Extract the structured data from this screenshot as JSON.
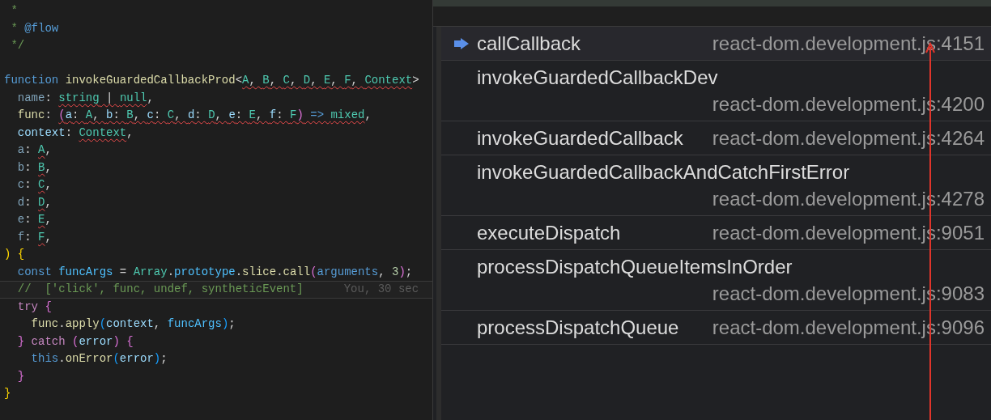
{
  "editor": {
    "lines": [
      {
        "current": false,
        "tokens": [
          {
            "text": " *",
            "kind": "comment",
            "squiggly": false
          }
        ]
      },
      {
        "current": false,
        "tokens": [
          {
            "text": " * ",
            "kind": "comment",
            "squiggly": false
          },
          {
            "text": "@flow",
            "kind": "tag",
            "squiggly": false
          }
        ]
      },
      {
        "current": false,
        "tokens": [
          {
            "text": " */",
            "kind": "comment",
            "squiggly": false
          }
        ]
      },
      {
        "current": false
      },
      {
        "current": false,
        "tokens": [
          {
            "text": "function ",
            "kind": "keyword",
            "squiggly": false
          },
          {
            "text": "invokeGuardedCallbackProd",
            "kind": "function",
            "squiggly": false
          },
          {
            "text": "<",
            "kind": "punct",
            "squiggly": false
          },
          {
            "text": "A",
            "kind": "type",
            "squiggly": true
          },
          {
            "text": ", ",
            "kind": "punct",
            "squiggly": true
          },
          {
            "text": "B",
            "kind": "type",
            "squiggly": true
          },
          {
            "text": ", ",
            "kind": "punct",
            "squiggly": true
          },
          {
            "text": "C",
            "kind": "type",
            "squiggly": true
          },
          {
            "text": ", ",
            "kind": "punct",
            "squiggly": true
          },
          {
            "text": "D",
            "kind": "type",
            "squiggly": true
          },
          {
            "text": ", ",
            "kind": "punct",
            "squiggly": true
          },
          {
            "text": "E",
            "kind": "type",
            "squiggly": true
          },
          {
            "text": ", ",
            "kind": "punct",
            "squiggly": true
          },
          {
            "text": "F",
            "kind": "type",
            "squiggly": true
          },
          {
            "text": ", ",
            "kind": "punct",
            "squiggly": true
          },
          {
            "text": "Context",
            "kind": "type",
            "squiggly": true
          },
          {
            "text": ">",
            "kind": "punct",
            "squiggly": false
          }
        ]
      },
      {
        "current": false,
        "tokens": [
          {
            "text": "  name",
            "kind": "param_dim",
            "squiggly": false
          },
          {
            "text": ": ",
            "kind": "punct",
            "squiggly": false
          },
          {
            "text": "string",
            "kind": "type",
            "squiggly": true
          },
          {
            "text": " | ",
            "kind": "punct",
            "squiggly": true
          },
          {
            "text": "null",
            "kind": "type",
            "squiggly": true
          },
          {
            "text": ",",
            "kind": "punct",
            "squiggly": false
          }
        ]
      },
      {
        "current": false,
        "tokens": [
          {
            "text": "  func",
            "kind": "function",
            "squiggly": false
          },
          {
            "text": ": ",
            "kind": "punct",
            "squiggly": false
          },
          {
            "text": "(",
            "kind": "bracket2",
            "squiggly": true
          },
          {
            "text": "a",
            "kind": "param",
            "squiggly": true
          },
          {
            "text": ": ",
            "kind": "punct",
            "squiggly": true
          },
          {
            "text": "A",
            "kind": "type",
            "squiggly": true
          },
          {
            "text": ", ",
            "kind": "punct",
            "squiggly": true
          },
          {
            "text": "b",
            "kind": "param",
            "squiggly": true
          },
          {
            "text": ": ",
            "kind": "punct",
            "squiggly": true
          },
          {
            "text": "B",
            "kind": "type",
            "squiggly": true
          },
          {
            "text": ", ",
            "kind": "punct",
            "squiggly": true
          },
          {
            "text": "c",
            "kind": "param",
            "squiggly": true
          },
          {
            "text": ": ",
            "kind": "punct",
            "squiggly": true
          },
          {
            "text": "C",
            "kind": "type",
            "squiggly": true
          },
          {
            "text": ", ",
            "kind": "punct",
            "squiggly": true
          },
          {
            "text": "d",
            "kind": "param",
            "squiggly": true
          },
          {
            "text": ": ",
            "kind": "punct",
            "squiggly": true
          },
          {
            "text": "D",
            "kind": "type",
            "squiggly": true
          },
          {
            "text": ", ",
            "kind": "punct",
            "squiggly": true
          },
          {
            "text": "e",
            "kind": "param",
            "squiggly": true
          },
          {
            "text": ": ",
            "kind": "punct",
            "squiggly": true
          },
          {
            "text": "E",
            "kind": "type",
            "squiggly": true
          },
          {
            "text": ", ",
            "kind": "punct",
            "squiggly": true
          },
          {
            "text": "f",
            "kind": "param",
            "squiggly": true
          },
          {
            "text": ": ",
            "kind": "punct",
            "squiggly": true
          },
          {
            "text": "F",
            "kind": "type",
            "squiggly": true
          },
          {
            "text": ")",
            "kind": "bracket2",
            "squiggly": true
          },
          {
            "text": " => ",
            "kind": "keyword",
            "squiggly": true
          },
          {
            "text": "mixed",
            "kind": "type",
            "squiggly": true
          },
          {
            "text": ",",
            "kind": "punct",
            "squiggly": false
          }
        ]
      },
      {
        "current": false,
        "tokens": [
          {
            "text": "  context",
            "kind": "param",
            "squiggly": false
          },
          {
            "text": ": ",
            "kind": "punct",
            "squiggly": false
          },
          {
            "text": "Context",
            "kind": "type",
            "squiggly": true
          },
          {
            "text": ",",
            "kind": "punct",
            "squiggly": false
          }
        ]
      },
      {
        "current": false,
        "tokens": [
          {
            "text": "  a",
            "kind": "param_dim",
            "squiggly": false
          },
          {
            "text": ": ",
            "kind": "punct",
            "squiggly": false
          },
          {
            "text": "A",
            "kind": "type",
            "squiggly": true
          },
          {
            "text": ",",
            "kind": "punct",
            "squiggly": false
          }
        ]
      },
      {
        "current": false,
        "tokens": [
          {
            "text": "  b",
            "kind": "param_dim",
            "squiggly": false
          },
          {
            "text": ": ",
            "kind": "punct",
            "squiggly": false
          },
          {
            "text": "B",
            "kind": "type",
            "squiggly": true
          },
          {
            "text": ",",
            "kind": "punct",
            "squiggly": false
          }
        ]
      },
      {
        "current": false,
        "tokens": [
          {
            "text": "  c",
            "kind": "param_dim",
            "squiggly": false
          },
          {
            "text": ": ",
            "kind": "punct",
            "squiggly": false
          },
          {
            "text": "C",
            "kind": "type",
            "squiggly": true
          },
          {
            "text": ",",
            "kind": "punct",
            "squiggly": false
          }
        ]
      },
      {
        "current": false,
        "tokens": [
          {
            "text": "  d",
            "kind": "param_dim",
            "squiggly": false
          },
          {
            "text": ": ",
            "kind": "punct",
            "squiggly": false
          },
          {
            "text": "D",
            "kind": "type",
            "squiggly": true
          },
          {
            "text": ",",
            "kind": "punct",
            "squiggly": false
          }
        ]
      },
      {
        "current": false,
        "tokens": [
          {
            "text": "  e",
            "kind": "param_dim",
            "squiggly": false
          },
          {
            "text": ": ",
            "kind": "punct",
            "squiggly": false
          },
          {
            "text": "E",
            "kind": "type",
            "squiggly": true
          },
          {
            "text": ",",
            "kind": "punct",
            "squiggly": false
          }
        ]
      },
      {
        "current": false,
        "tokens": [
          {
            "text": "  f",
            "kind": "param_dim",
            "squiggly": false
          },
          {
            "text": ": ",
            "kind": "punct",
            "squiggly": false
          },
          {
            "text": "F",
            "kind": "type",
            "squiggly": true
          },
          {
            "text": ",",
            "kind": "punct",
            "squiggly": false
          }
        ]
      },
      {
        "current": false,
        "tokens": [
          {
            "text": ") ",
            "kind": "bracket",
            "squiggly": false
          },
          {
            "text": "{",
            "kind": "bracket",
            "squiggly": false
          }
        ]
      },
      {
        "current": false,
        "tokens": [
          {
            "text": "  const ",
            "kind": "keyword",
            "squiggly": false
          },
          {
            "text": "funcArgs",
            "kind": "variable",
            "squiggly": false
          },
          {
            "text": " = ",
            "kind": "punct",
            "squiggly": false
          },
          {
            "text": "Array",
            "kind": "type",
            "squiggly": false
          },
          {
            "text": ".",
            "kind": "punct",
            "squiggly": false
          },
          {
            "text": "prototype",
            "kind": "variable",
            "squiggly": false
          },
          {
            "text": ".",
            "kind": "punct",
            "squiggly": false
          },
          {
            "text": "slice",
            "kind": "function",
            "squiggly": false
          },
          {
            "text": ".",
            "kind": "punct",
            "squiggly": false
          },
          {
            "text": "call",
            "kind": "function",
            "squiggly": false
          },
          {
            "text": "(",
            "kind": "bracket2",
            "squiggly": false
          },
          {
            "text": "arguments",
            "kind": "keyword",
            "squiggly": false
          },
          {
            "text": ", ",
            "kind": "punct",
            "squiggly": false
          },
          {
            "text": "3",
            "kind": "number",
            "squiggly": false
          },
          {
            "text": ")",
            "kind": "bracket2",
            "squiggly": false
          },
          {
            "text": ";",
            "kind": "punct",
            "squiggly": false
          }
        ]
      },
      {
        "current": true,
        "blame": "You, 30 sec",
        "tokens": [
          {
            "text": "  //  ['click', func, undef, syntheticEvent]",
            "kind": "comment",
            "squiggly": false
          }
        ]
      },
      {
        "current": false,
        "tokens": [
          {
            "text": "  try ",
            "kind": "control",
            "squiggly": false
          },
          {
            "text": "{",
            "kind": "bracket2",
            "squiggly": false
          }
        ]
      },
      {
        "current": false,
        "tokens": [
          {
            "text": "    func",
            "kind": "function",
            "squiggly": false
          },
          {
            "text": ".",
            "kind": "punct",
            "squiggly": false
          },
          {
            "text": "apply",
            "kind": "function",
            "squiggly": false
          },
          {
            "text": "(",
            "kind": "bracket3",
            "squiggly": false
          },
          {
            "text": "context",
            "kind": "param",
            "squiggly": false
          },
          {
            "text": ", ",
            "kind": "punct",
            "squiggly": false
          },
          {
            "text": "funcArgs",
            "kind": "variable",
            "squiggly": false
          },
          {
            "text": ")",
            "kind": "bracket3",
            "squiggly": false
          },
          {
            "text": ";",
            "kind": "punct",
            "squiggly": false
          }
        ]
      },
      {
        "current": false,
        "tokens": [
          {
            "text": "  }",
            "kind": "bracket2",
            "squiggly": false
          },
          {
            "text": " catch ",
            "kind": "control",
            "squiggly": false
          },
          {
            "text": "(",
            "kind": "bracket2",
            "squiggly": false
          },
          {
            "text": "error",
            "kind": "param",
            "squiggly": false
          },
          {
            "text": ") ",
            "kind": "bracket2",
            "squiggly": false
          },
          {
            "text": "{",
            "kind": "bracket2",
            "squiggly": false
          }
        ]
      },
      {
        "current": false,
        "tokens": [
          {
            "text": "    this",
            "kind": "keyword",
            "squiggly": false
          },
          {
            "text": ".",
            "kind": "punct",
            "squiggly": false
          },
          {
            "text": "onError",
            "kind": "function",
            "squiggly": false
          },
          {
            "text": "(",
            "kind": "bracket3",
            "squiggly": false
          },
          {
            "text": "error",
            "kind": "param",
            "squiggly": false
          },
          {
            "text": ")",
            "kind": "bracket3",
            "squiggly": false
          },
          {
            "text": ";",
            "kind": "punct",
            "squiggly": false
          }
        ]
      },
      {
        "current": false,
        "tokens": [
          {
            "text": "  }",
            "kind": "bracket2",
            "squiggly": false
          }
        ]
      },
      {
        "current": false,
        "tokens": [
          {
            "text": "}",
            "kind": "bracket",
            "squiggly": false
          }
        ]
      }
    ]
  },
  "call_stack": {
    "frames": [
      {
        "name": "callCallback",
        "location": "react-dom.development.js:4151",
        "current": true
      },
      {
        "name": "invokeGuardedCallbackDev",
        "location": "react-dom.development.js:4200",
        "current": false
      },
      {
        "name": "invokeGuardedCallback",
        "location": "react-dom.development.js:4264",
        "current": false
      },
      {
        "name": "invokeGuardedCallbackAndCatchFirstError",
        "location": "react-dom.development.js:4278",
        "current": false
      },
      {
        "name": "executeDispatch",
        "location": "react-dom.development.js:9051",
        "current": false
      },
      {
        "name": "processDispatchQueueItemsInOrder",
        "location": "react-dom.development.js:9083",
        "current": false
      },
      {
        "name": "processDispatchQueue",
        "location": "react-dom.development.js:9096",
        "current": false
      }
    ]
  }
}
